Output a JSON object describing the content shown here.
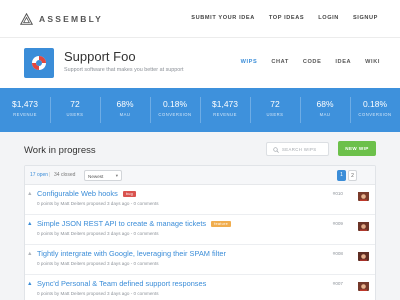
{
  "brand": {
    "name": "ASSEMBLY"
  },
  "top_nav": [
    "SUBMIT YOUR IDEA",
    "TOP IDEAS",
    "LOGIN",
    "SIGNUP"
  ],
  "product": {
    "title": "Support Foo",
    "subtitle": "Support software that makes you better at support",
    "tabs": [
      "WIPS",
      "CHAT",
      "CODE",
      "IDEA",
      "WIKI"
    ],
    "active_tab": "WIPS"
  },
  "stats": [
    {
      "value": "$1,473",
      "label": "REVENUE"
    },
    {
      "value": "72",
      "label": "USERS"
    },
    {
      "value": "68%",
      "label": "MAU"
    },
    {
      "value": "0.18%",
      "label": "CONVERSION"
    },
    {
      "value": "$1,473",
      "label": "REVENUE"
    },
    {
      "value": "72",
      "label": "USERS"
    },
    {
      "value": "68%",
      "label": "MAU"
    },
    {
      "value": "0.18%",
      "label": "CONVERSION"
    }
  ],
  "work": {
    "title": "Work in progress",
    "search_placeholder": "SEARCH WIPS",
    "new_button": "NEW WIP",
    "filter": {
      "open": "17 open",
      "separator": "|",
      "closed": "34 closed",
      "sort": "Newest",
      "pages": [
        "1",
        "2"
      ]
    }
  },
  "wips": [
    {
      "title": "Configurable Web hooks",
      "tag": "bug",
      "meta": "0 points by Matt Deiters proposed 3 days ago - 0 comments",
      "number": "#010",
      "upvoted": false
    },
    {
      "title": "Simple JSON REST API to create & manage tickets",
      "tag": "feature",
      "meta": "0 points by Matt Deiters proposed 3 days ago - 0 comments",
      "number": "#009",
      "upvoted": true
    },
    {
      "title": "Tightly intergrate with Google, leveraging their SPAM filter",
      "tag": "",
      "meta": "0 points by Matt Deiters proposed 3 days ago - 0 comments",
      "number": "#008",
      "upvoted": false
    },
    {
      "title": "Sync'd Personal & Team defined support responses",
      "tag": "",
      "meta": "0 points by Matt Deiters proposed 3 days ago - 0 comments",
      "number": "#007",
      "upvoted": true
    }
  ],
  "colors": {
    "accent": "#3e91dc",
    "success": "#6cc04a",
    "bug": "#d9534f",
    "feature": "#f0ad4e"
  },
  "icons": {
    "logo": "triangle-logo-icon",
    "product": "lifebuoy-icon",
    "search": "search-icon",
    "vote": "upvote-arrow-icon"
  }
}
